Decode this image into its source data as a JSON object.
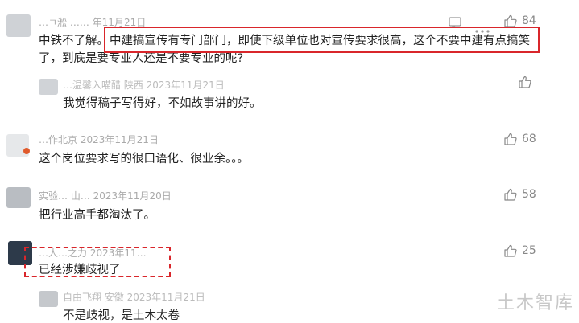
{
  "comments": [
    {
      "meta": "…ㄱ淞 …… 年11月21日",
      "text_a": "中铁不了解。",
      "text_b": "中建搞宣传有专门部门，即使下级单位也对宣传要求很高，这个不要中建有点搞笑",
      "text_c": "了，到底是要专业人还是不要专业的呢?",
      "likes": "84"
    },
    {
      "meta": "…温馨入喵醋 陕西 2023年11月21日",
      "text": "我觉得稿子写得好，不如故事讲的好。",
      "likes": ""
    },
    {
      "meta": "…作北京 2023年11月21日",
      "text": "这个岗位要求写的很口语化、很业余。。。",
      "likes": "68"
    },
    {
      "meta": "实验… 山… 2023年11月20日",
      "text": "把行业高手都淘汰了。",
      "likes": "58"
    },
    {
      "meta": "…人…之力 2023年11…",
      "text": "已经涉嫌歧视了",
      "likes": "25"
    },
    {
      "meta": "自由飞翔 安徽 2023年11月21日",
      "text": "不是歧视，是土木太卷",
      "likes": ""
    }
  ],
  "watermark": "土木智库",
  "colors": {
    "accent_red": "#d9262b",
    "meta_gray": "#aaaaaa"
  }
}
